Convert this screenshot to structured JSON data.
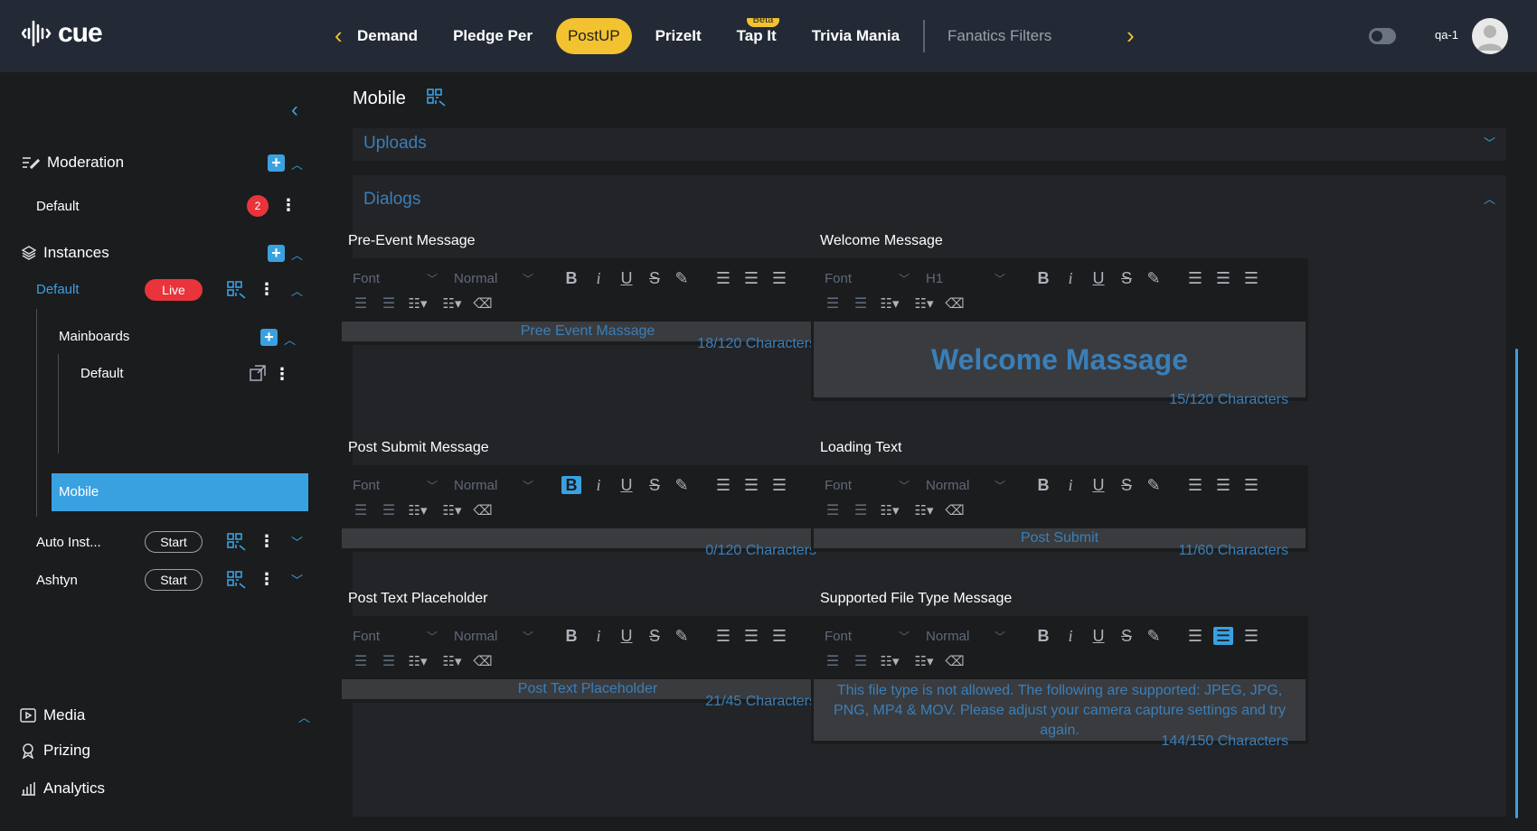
{
  "app": {
    "logo_text": "cue",
    "user": "qa-1"
  },
  "nav": {
    "prev_label": "‹",
    "next_label": "›",
    "tabs": [
      {
        "label": "Demand",
        "state": "cut"
      },
      {
        "label": "Pledge Per",
        "state": "normal"
      },
      {
        "label": "PostUP",
        "state": "active"
      },
      {
        "label": "PrizeIt",
        "state": "normal"
      },
      {
        "label": "Tap It",
        "state": "normal",
        "badge": "Beta"
      },
      {
        "label": "Trivia Mania",
        "state": "normal"
      },
      {
        "label": "Fanatics Filters",
        "state": "dim"
      }
    ]
  },
  "sidebar": {
    "moderation": {
      "title": "Moderation",
      "item": "Default",
      "count": "2"
    },
    "instances": {
      "title": "Instances",
      "default_label": "Default",
      "live_label": "Live",
      "mainboards_label": "Mainboards",
      "mainboard_default": "Default",
      "mobile_label": "Mobile",
      "auto_label": "Auto Inst...",
      "ashtyn_label": "Ashtyn",
      "start_label": "Start"
    },
    "bottom": {
      "media": "Media",
      "prizing": "Prizing",
      "analytics": "Analytics"
    }
  },
  "main": {
    "title": "Mobile",
    "uploads_title": "Uploads",
    "dialogs_title": "Dialogs",
    "toolbar": {
      "font": "Font",
      "normal": "Normal",
      "h1": "H1"
    },
    "fields": {
      "pre_event": {
        "label": "Pre-Event Message",
        "value": "Pree Event Massage",
        "counter": "18/120 Characters"
      },
      "welcome": {
        "label": "Welcome Message",
        "value": "Welcome Massage",
        "counter": "15/120 Characters"
      },
      "post_submit": {
        "label": "Post Submit Message",
        "value": "",
        "counter": "0/120 Characters"
      },
      "loading": {
        "label": "Loading Text",
        "value": "Post Submit",
        "counter": "11/60 Characters"
      },
      "placeholder": {
        "label": "Post Text Placeholder",
        "value": "Post Text Placeholder",
        "counter": "21/45 Characters"
      },
      "filetype": {
        "label": "Supported File Type Message",
        "value": "This file type is not allowed. The following are supported: JPEG, JPG, PNG, MP4 & MOV. Please adjust your camera capture settings and try again.",
        "counter": "144/150 Characters"
      }
    }
  },
  "colors": {
    "accent": "#3aa1e0",
    "brand": "#f2c230",
    "live": "#e8343a",
    "topbar": "#232a36"
  }
}
